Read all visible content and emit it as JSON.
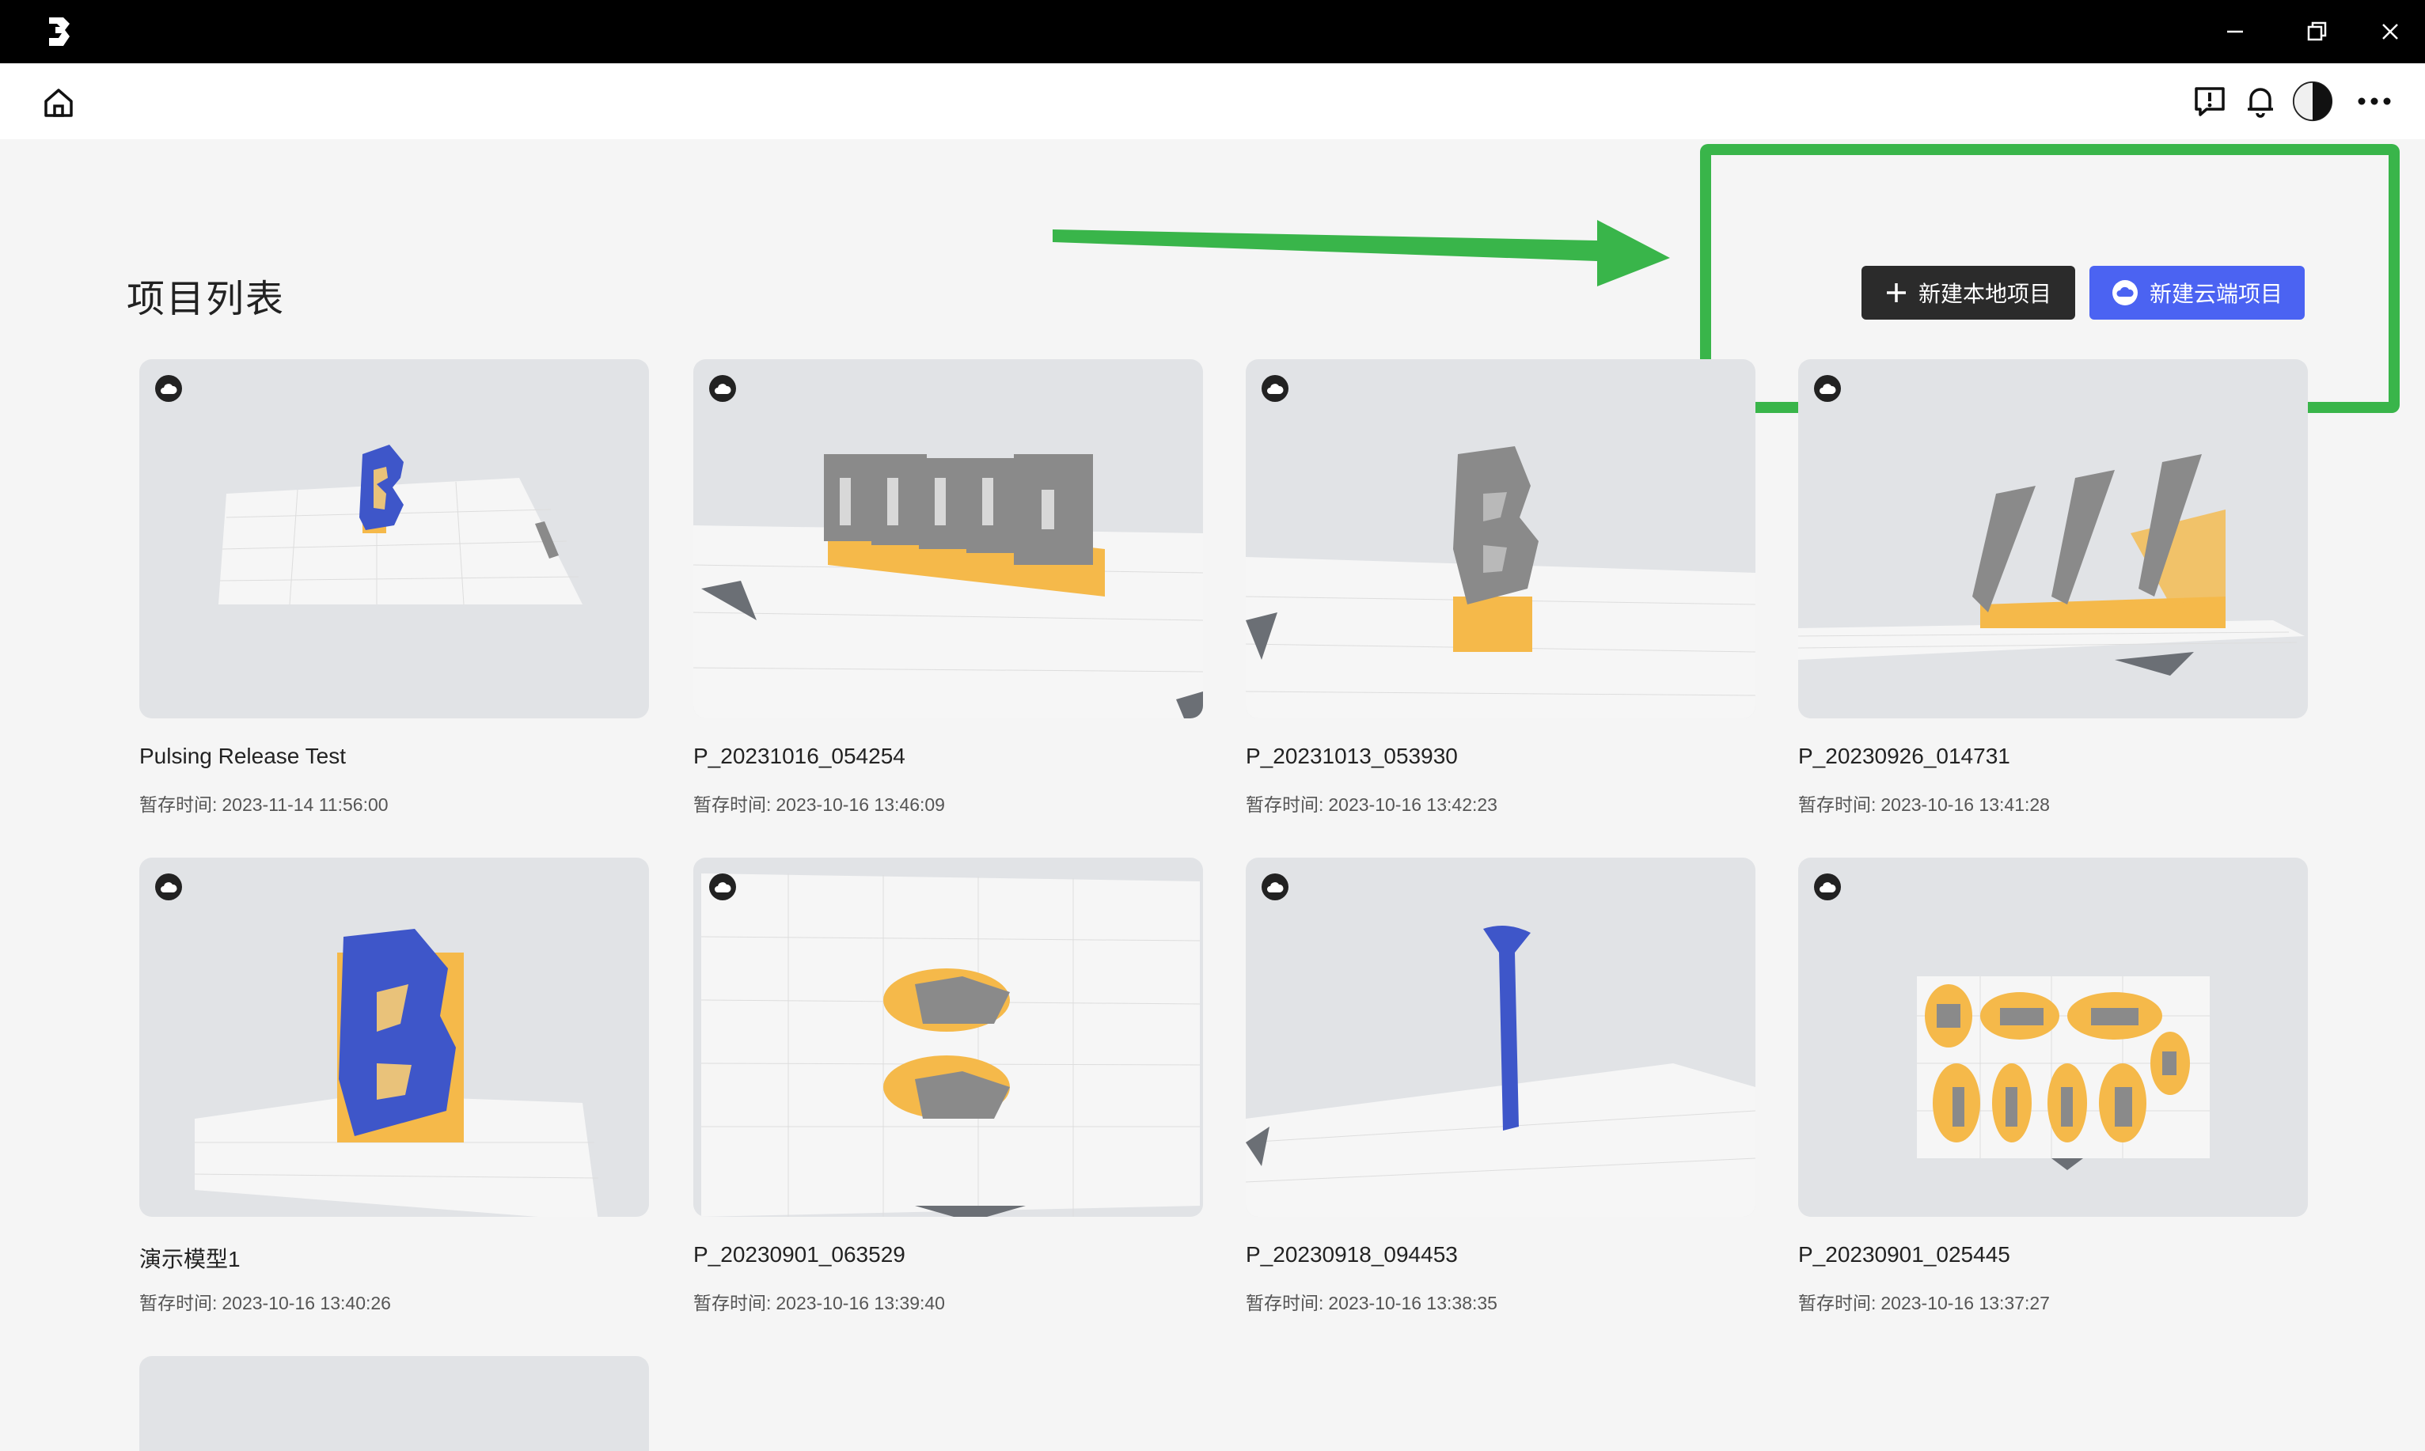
{
  "window": {
    "logo_icon": "app-logo-icon",
    "controls": [
      "minimize-icon",
      "maximize-icon",
      "close-icon"
    ]
  },
  "header": {
    "home_icon": "home-icon",
    "right_icons": [
      "feedback-icon",
      "bell-icon",
      "theme-toggle-icon",
      "more-icon"
    ]
  },
  "page": {
    "title": "项目列表",
    "new_local_label": "新建本地项目",
    "new_cloud_label": "新建云端项目"
  },
  "annotation": {
    "highlight_color": "#39b54a"
  },
  "colors": {
    "accent": "#4b63f2",
    "dark_button": "#2b2b2b",
    "model_blue": "#3e56c9",
    "support_orange": "#f5b94a",
    "model_gray": "#8a8a8a"
  },
  "time_label": "暂存时间:",
  "projects": [
    {
      "name": "Pulsing Release Test",
      "time": "2023-11-14 11:56:00",
      "cloud": true
    },
    {
      "name": "P_20231016_054254",
      "time": "2023-10-16 13:46:09",
      "cloud": true
    },
    {
      "name": "P_20231013_053930",
      "time": "2023-10-16 13:42:23",
      "cloud": true
    },
    {
      "name": "P_20230926_014731",
      "time": "2023-10-16 13:41:28",
      "cloud": true
    },
    {
      "name": "演示模型1",
      "time": "2023-10-16 13:40:26",
      "cloud": true
    },
    {
      "name": "P_20230901_063529",
      "time": "2023-10-16 13:39:40",
      "cloud": true
    },
    {
      "name": "P_20230918_094453",
      "time": "2023-10-16 13:38:35",
      "cloud": true
    },
    {
      "name": "P_20230901_025445",
      "time": "2023-10-16 13:37:27",
      "cloud": true
    }
  ]
}
